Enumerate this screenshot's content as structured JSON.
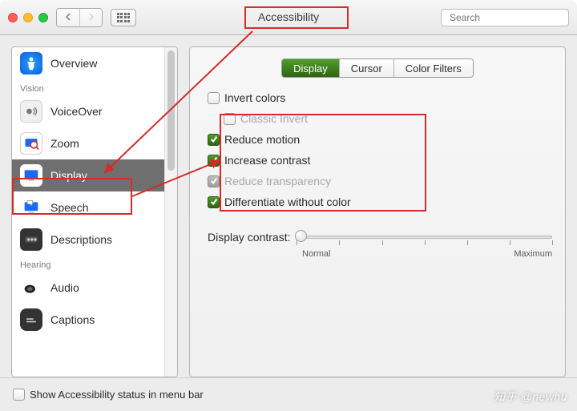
{
  "window": {
    "title": "Accessibility",
    "search_placeholder": "Search"
  },
  "sidebar": {
    "groups": [
      {
        "label": "",
        "items": [
          {
            "id": "overview",
            "label": "Overview"
          }
        ]
      },
      {
        "label": "Vision",
        "items": [
          {
            "id": "voiceover",
            "label": "VoiceOver"
          },
          {
            "id": "zoom",
            "label": "Zoom"
          },
          {
            "id": "display",
            "label": "Display",
            "selected": true
          },
          {
            "id": "speech",
            "label": "Speech"
          },
          {
            "id": "descriptions",
            "label": "Descriptions"
          }
        ]
      },
      {
        "label": "Hearing",
        "items": [
          {
            "id": "audio",
            "label": "Audio"
          },
          {
            "id": "captions",
            "label": "Captions"
          }
        ]
      }
    ]
  },
  "tabs": {
    "items": [
      "Display",
      "Cursor",
      "Color Filters"
    ],
    "active_index": 0
  },
  "checkboxes": {
    "invert_colors": {
      "label": "Invert colors",
      "checked": false,
      "disabled": false
    },
    "classic_invert": {
      "label": "Classic Invert",
      "checked": false,
      "disabled": true
    },
    "reduce_motion": {
      "label": "Reduce motion",
      "checked": true,
      "disabled": false
    },
    "increase_contrast": {
      "label": "Increase contrast",
      "checked": true,
      "disabled": false
    },
    "reduce_transparency": {
      "label": "Reduce transparency",
      "checked": true,
      "disabled": true
    },
    "differentiate": {
      "label": "Differentiate without color",
      "checked": true,
      "disabled": false
    }
  },
  "slider": {
    "label": "Display contrast:",
    "min_label": "Normal",
    "max_label": "Maximum",
    "value_pct": 0,
    "ticks": 7
  },
  "footer": {
    "show_status_label": "Show Accessibility status in menu bar",
    "show_status_checked": false
  },
  "watermark": "知乎 @newhu"
}
